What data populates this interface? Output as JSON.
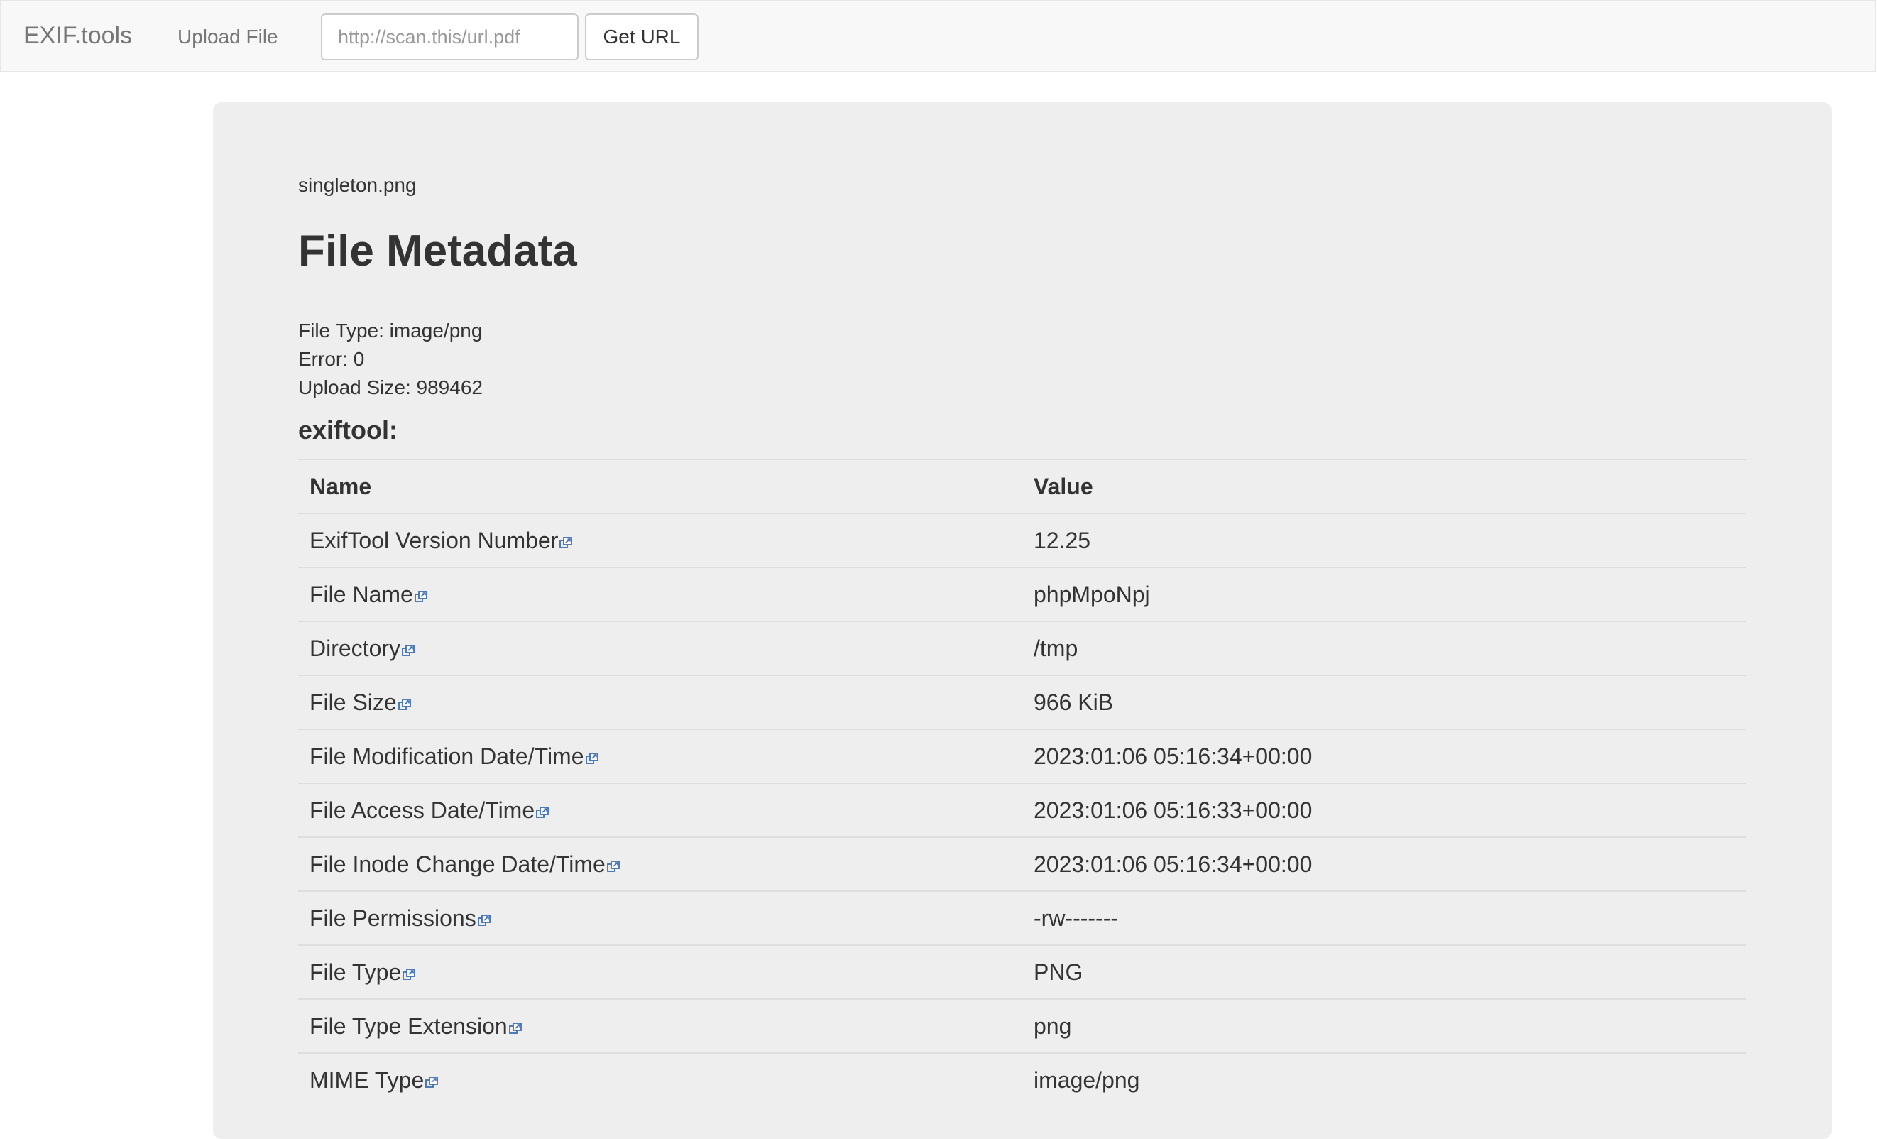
{
  "navbar": {
    "brand": "EXIF.tools",
    "upload_label": "Upload File",
    "url_placeholder": "http://scan.this/url.pdf",
    "get_url_label": "Get URL"
  },
  "file": {
    "name": "singleton.png",
    "title": "File Metadata",
    "info": [
      "File Type: image/png",
      "Error: 0",
      "Upload Size: 989462"
    ]
  },
  "section": {
    "title": "exiftool:"
  },
  "table": {
    "headers": [
      "Name",
      "Value"
    ],
    "rows": [
      {
        "name": "ExifTool Version Number",
        "value": "12.25",
        "icon": "external-link-icon"
      },
      {
        "name": "File Name",
        "value": "phpMpoNpj",
        "icon": "external-link-icon"
      },
      {
        "name": "Directory",
        "value": "/tmp",
        "icon": "external-link-icon"
      },
      {
        "name": "File Size",
        "value": "966 KiB",
        "icon": "external-link-icon"
      },
      {
        "name": "File Modification Date/Time",
        "value": "2023:01:06 05:16:34+00:00",
        "icon": "external-link-icon"
      },
      {
        "name": "File Access Date/Time",
        "value": "2023:01:06 05:16:33+00:00",
        "icon": "external-link-icon"
      },
      {
        "name": "File Inode Change Date/Time",
        "value": "2023:01:06 05:16:34+00:00",
        "icon": "external-link-icon"
      },
      {
        "name": "File Permissions",
        "value": "-rw-------",
        "icon": "external-link-icon"
      },
      {
        "name": "File Type",
        "value": "PNG",
        "icon": "external-link-icon"
      },
      {
        "name": "File Type Extension",
        "value": "png",
        "icon": "external-link-icon"
      },
      {
        "name": "MIME Type",
        "value": "image/png",
        "icon": "external-link-icon"
      }
    ]
  },
  "colors": {
    "link_icon": "#3d6eb4",
    "panel_bg": "#eeeeee",
    "navbar_bg": "#f8f8f8"
  }
}
